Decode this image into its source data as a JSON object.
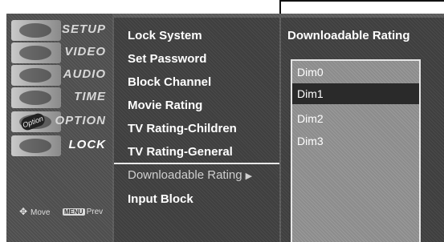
{
  "sidebar": {
    "items": [
      {
        "label": "SETUP",
        "icon": "setup-thumbnail-icon"
      },
      {
        "label": "VIDEO",
        "icon": "video-thumbnail-icon"
      },
      {
        "label": "AUDIO",
        "icon": "audio-thumbnail-icon"
      },
      {
        "label": "TIME",
        "icon": "time-thumbnail-icon"
      },
      {
        "label": "OPTION",
        "icon": "option-thumbnail-icon",
        "badge": "Option"
      },
      {
        "label": "LOCK",
        "icon": "lock-thumbnail-icon"
      }
    ],
    "active": "LOCK"
  },
  "hints": {
    "move_label": "Move",
    "menu_key": "MENU",
    "prev_label": "Prev"
  },
  "menu": {
    "items": [
      {
        "label": "Lock System"
      },
      {
        "label": "Set Password"
      },
      {
        "label": "Block Channel"
      },
      {
        "label": "Movie Rating"
      },
      {
        "label": "TV Rating-Children"
      },
      {
        "label": "TV Rating-General"
      },
      {
        "label": "Downloadable Rating",
        "selected": true,
        "arrow": "▶"
      },
      {
        "label": "Input Block"
      }
    ]
  },
  "panel": {
    "title": "Downloadable Rating",
    "options": [
      "Dim0",
      "Dim1",
      "Dim2",
      "Dim3"
    ],
    "highlighted": "Dim1"
  }
}
